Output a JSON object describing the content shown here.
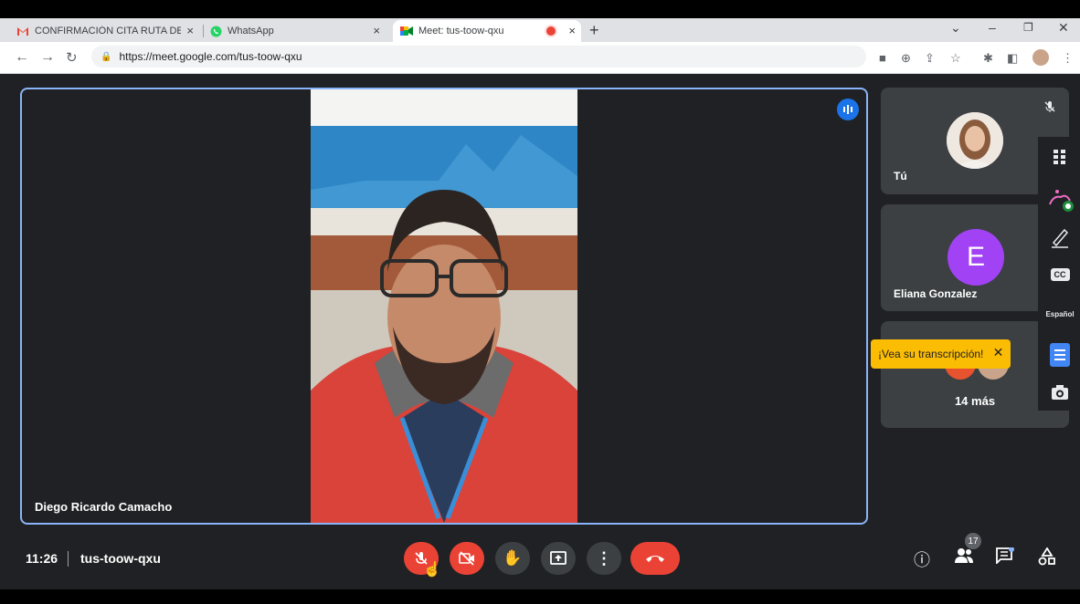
{
  "browser": {
    "tabs": [
      {
        "label": "CONFIRMACIÓN CITA RUTA DE E",
        "icon": "gmail-icon"
      },
      {
        "label": "WhatsApp",
        "icon": "whatsapp-icon"
      },
      {
        "label": "Meet: tus-toow-qxu",
        "icon": "meet-icon"
      }
    ],
    "close_glyph": "×",
    "new_tab_glyph": "+",
    "url": "https://meet.google.com/tus-toow-qxu"
  },
  "meet": {
    "main_speaker": "Diego Ricardo Camacho",
    "participants": [
      {
        "name": "Tú"
      },
      {
        "name": "Eliana Gonzalez",
        "initial": "E",
        "color": "#a142f4"
      }
    ],
    "more_label": "14 más",
    "tooltip": "¡Vea su transcripción!",
    "language": "Español",
    "cc_label": "CC",
    "time": "11:26",
    "meeting_code": "tus-toow-qxu",
    "people_count": "17",
    "colors": {
      "accent": "#8ab4f8",
      "end_call": "#ea4335",
      "tooltip": "#fbbc04"
    }
  }
}
